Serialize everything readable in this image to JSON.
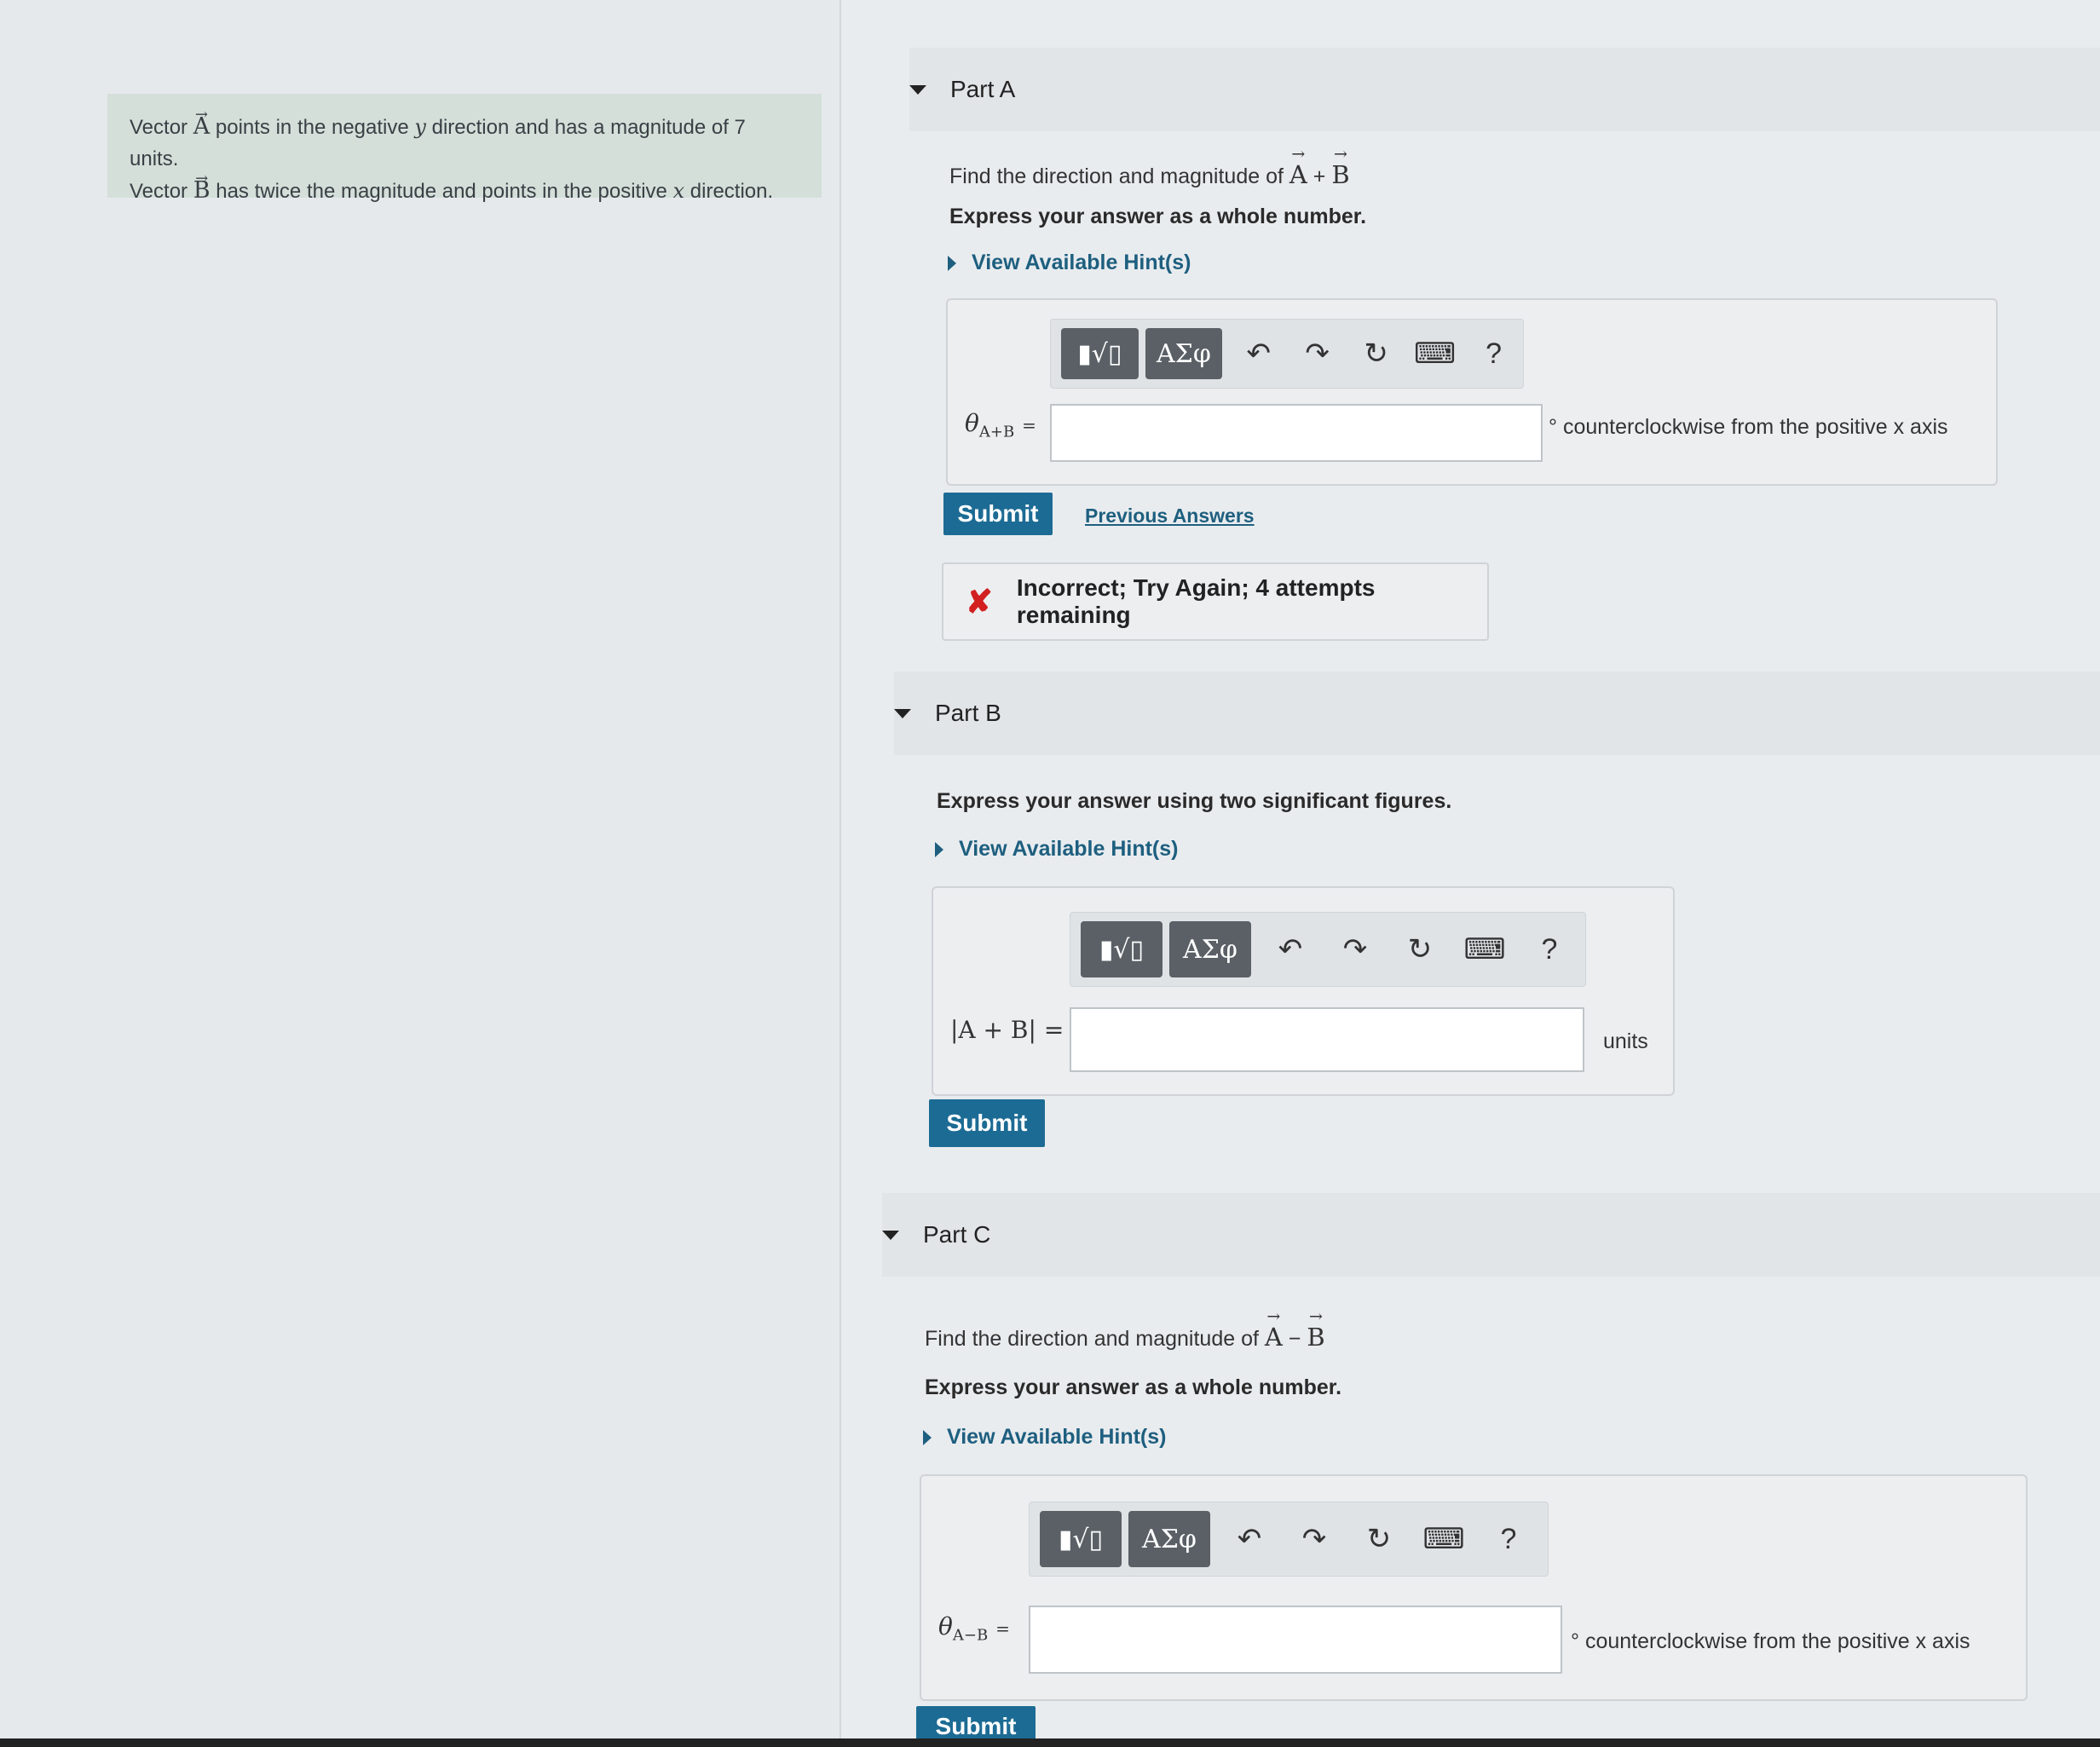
{
  "intro": {
    "line1_pre": "Vector ",
    "vec_a": "A",
    "line1_mid": " points in the negative ",
    "var_y": "y",
    "line1_post": " direction and has a magnitude of 7 units.",
    "line2_pre": "Vector ",
    "vec_b": "B",
    "line2_mid": " has twice the magnitude and points in the positive ",
    "var_x": "x",
    "line2_post": " direction."
  },
  "common": {
    "arrow": "→",
    "hint_label": "View Available Hint(s)",
    "submit_label": "Submit",
    "toolbar_templates": "▮√▯",
    "toolbar_greek": "ΑΣφ",
    "undo": "↶",
    "redo": "↷",
    "reset": "↻",
    "keyboard": "⌨",
    "help": "?"
  },
  "partA": {
    "title": "Part A",
    "question_pre": "Find the direction and magnitude of ",
    "vec_a": "A",
    "op": " + ",
    "vec_b": "B",
    "express": "Express your answer as a whole number.",
    "input_label": "θ",
    "input_sub": "A+B",
    "equals": "=",
    "unit_degree": "°",
    "unit_text": "counterclockwise from the positive x axis",
    "previous_answers": "Previous Answers",
    "feedback": "Incorrect; Try Again; 4 attempts remaining",
    "feedback_icon": "✘"
  },
  "partB": {
    "title": "Part B",
    "express": "Express your answer using two significant figures.",
    "input_label": "|A + B| =",
    "unit_text": "units"
  },
  "partC": {
    "title": "Part C",
    "question_pre": "Find the direction and magnitude of ",
    "vec_a": "A",
    "op": " − ",
    "vec_b": "B",
    "express": "Express your answer as a whole number.",
    "input_label": "θ",
    "input_sub": "A−B",
    "equals": "=",
    "unit_degree": "°",
    "unit_text": "counterclockwise from the positive x axis"
  }
}
